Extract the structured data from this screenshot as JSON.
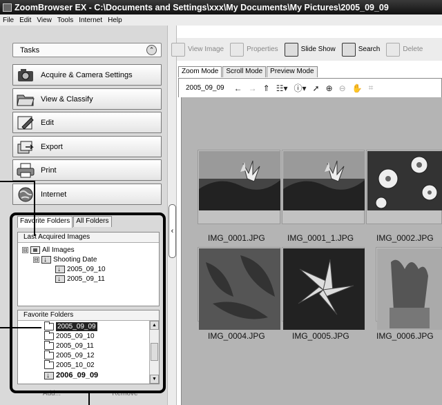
{
  "window": {
    "title": "ZoomBrowser EX  -  C:\\Documents and Settings\\xxx\\My Documents\\My Pictures\\2005_09_09"
  },
  "menu": [
    "File",
    "Edit",
    "View",
    "Tools",
    "Internet",
    "Help"
  ],
  "tasks": {
    "header": "Tasks",
    "buttons": [
      "Acquire & Camera Settings",
      "View & Classify",
      "Edit",
      "Export",
      "Print",
      "Internet"
    ]
  },
  "folder_panel": {
    "tabs": [
      "Favorite Folders",
      "All Folders"
    ],
    "last_acquired": {
      "title": "Last Acquired Images",
      "tree": [
        {
          "label": "All Images",
          "level": 0,
          "expander": "⊟",
          "icon": "pics"
        },
        {
          "label": "Shooting Date",
          "level": 1,
          "expander": "⊟",
          "icon": "date"
        },
        {
          "label": "2005_09_10",
          "level": 2,
          "icon": "date"
        },
        {
          "label": "2005_09_11",
          "level": 2,
          "icon": "date"
        }
      ]
    },
    "favorites": {
      "title": "Favorite Folders",
      "items": [
        {
          "label": "2005_09_09",
          "selected": true,
          "icon": "folder"
        },
        {
          "label": "2005_09_10",
          "icon": "folder"
        },
        {
          "label": "2005_09_11",
          "icon": "folder"
        },
        {
          "label": "2005_09_12",
          "icon": "folder"
        },
        {
          "label": "2005_10_02",
          "icon": "folder"
        },
        {
          "label": "2006_09_09",
          "icon": "date",
          "bold": true
        }
      ]
    },
    "bottom_buttons": [
      "Add...",
      "Remove"
    ]
  },
  "toolbar": {
    "items": [
      {
        "label": "View Image",
        "enabled": false,
        "icon": "view-image-icon"
      },
      {
        "label": "Properties",
        "enabled": false,
        "icon": "properties-icon"
      },
      {
        "label": "Slide Show",
        "enabled": true,
        "icon": "slideshow-icon"
      },
      {
        "label": "Search",
        "enabled": true,
        "icon": "search-icon"
      },
      {
        "label": "Delete",
        "enabled": false,
        "icon": "trash-icon"
      }
    ]
  },
  "mode_tabs": [
    "Zoom Mode",
    "Scroll Mode",
    "Preview Mode"
  ],
  "view_toolbar": {
    "folder": "2005_09_09"
  },
  "thumbnails": [
    {
      "filename": "IMG_0001.JPG",
      "palette": "lily-sky"
    },
    {
      "filename": "IMG_0001_1.JPG",
      "palette": "lily-sky"
    },
    {
      "filename": "IMG_0002.JPG",
      "palette": "flowers"
    },
    {
      "filename": "IMG_0004.JPG",
      "palette": "leaves"
    },
    {
      "filename": "IMG_0005.JPG",
      "palette": "lily-dark"
    },
    {
      "filename": "IMG_0006.JPG",
      "palette": "pot"
    }
  ]
}
